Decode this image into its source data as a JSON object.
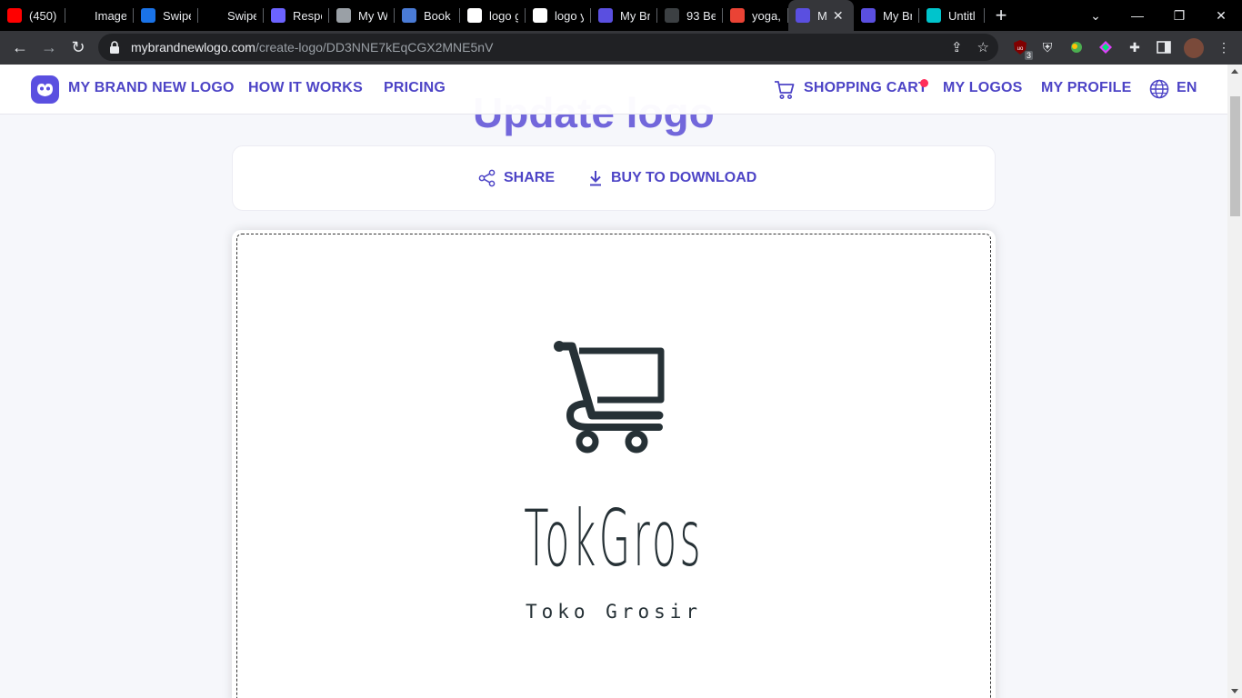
{
  "browser": {
    "tabs": [
      {
        "title": "(450) I",
        "favicon": "youtube-icon",
        "color": "#ff0000"
      },
      {
        "title": "Image",
        "favicon": "blank-icon",
        "color": "#000000"
      },
      {
        "title": "Swipe",
        "favicon": "swiper-icon",
        "color": "#1a73e8"
      },
      {
        "title": "Swipe",
        "favicon": "square-icon",
        "color": "#000000"
      },
      {
        "title": "Respo",
        "favicon": "cl-icon",
        "color": "#6c63ff"
      },
      {
        "title": "My W",
        "favicon": "globe-icon",
        "color": "#9aa0a6"
      },
      {
        "title": "Book",
        "favicon": "gear-icon",
        "color": "#4a7bd6"
      },
      {
        "title": "logo g",
        "favicon": "google-icon",
        "color": "#ffffff"
      },
      {
        "title": "logo y",
        "favicon": "google-icon",
        "color": "#ffffff"
      },
      {
        "title": "My Br",
        "favicon": "mybrandnewlogo-icon",
        "color": "#5a4fe0"
      },
      {
        "title": "93 Be",
        "favicon": "image-icon",
        "color": "#3c4043"
      },
      {
        "title": "yoga,",
        "favicon": "gmail-icon",
        "color": "#ea4335"
      },
      {
        "title": "M",
        "favicon": "mybrandnewlogo-icon",
        "color": "#5a4fe0",
        "active": true
      },
      {
        "title": "My Br",
        "favicon": "mybrandnewlogo-icon",
        "color": "#5a4fe0"
      },
      {
        "title": "Untitl",
        "favicon": "canva-icon",
        "color": "#00c4cc"
      }
    ],
    "url_host": "mybrandnewlogo.com",
    "url_path": "/create-logo/DD3NNE7kEqCGX2MNE5nV",
    "extension_badge": "3"
  },
  "nav": {
    "brand": "MY BRAND NEW LOGO",
    "how_it_works": "HOW IT WORKS",
    "pricing": "PRICING",
    "shopping_cart": "SHOPPING CART",
    "my_logos": "MY LOGOS",
    "my_profile": "MY PROFILE",
    "language": "EN"
  },
  "page": {
    "ghost_title": "Update logo",
    "share_label": "SHARE",
    "buy_label": "BUY TO DOWNLOAD"
  },
  "logo": {
    "name": "TokGros",
    "tagline": "Toko Grosir",
    "icon": "shopping-cart-icon",
    "color": "#263136"
  },
  "colors": {
    "brand": "#4d44c6",
    "notification": "#ff2e5b"
  }
}
